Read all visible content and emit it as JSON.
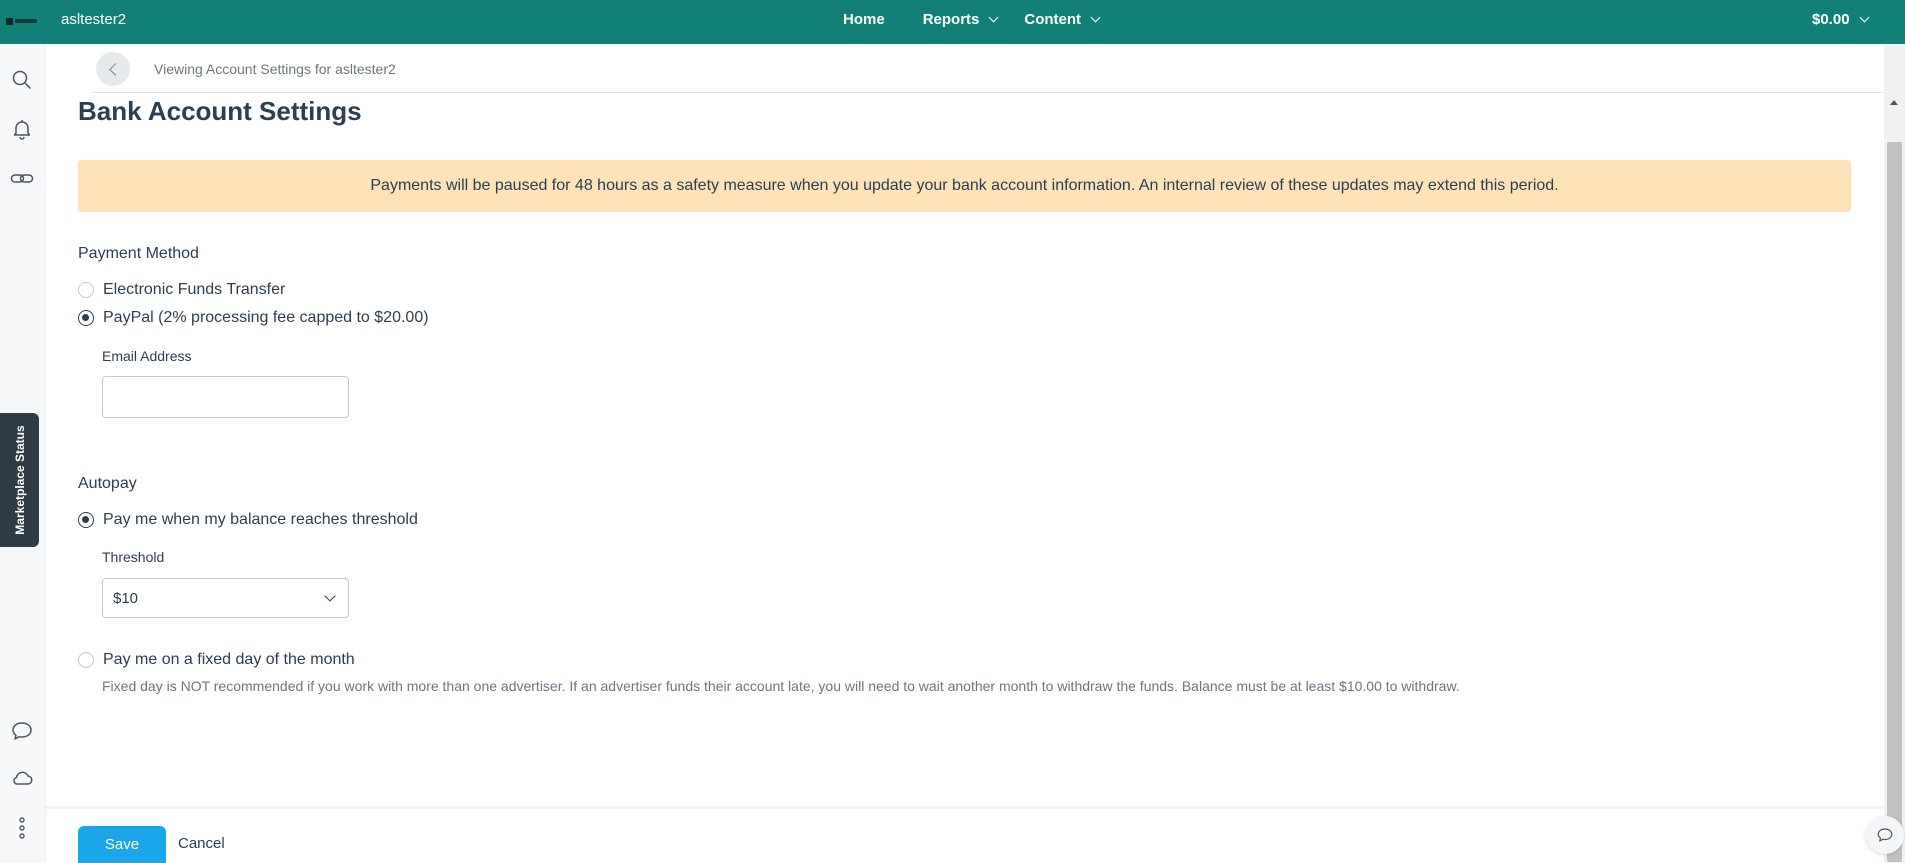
{
  "topbar": {
    "account_name": "asltester2",
    "nav": [
      {
        "label": "Home"
      },
      {
        "label": "Reports"
      },
      {
        "label": "Content"
      }
    ],
    "balance": "$0.00",
    "color": "#138078"
  },
  "sidebar": {
    "icons": [
      "search-icon",
      "bell-icon",
      "link-icon",
      "chat-icon",
      "cloud-icon",
      "more-icon"
    ],
    "marketplace_tab": "Marketplace Status"
  },
  "header": {
    "viewing_text": "Viewing Account Settings for asltester2"
  },
  "page": {
    "title": "Bank Account Settings",
    "notice": "Payments will be paused for 48 hours as a safety measure when you update your bank account information. An internal review of these updates may extend this period."
  },
  "payment_method": {
    "label": "Payment Method",
    "options": [
      {
        "label": "Electronic Funds Transfer",
        "checked": false
      },
      {
        "label": "PayPal (2% processing fee capped to $20.00)",
        "checked": true
      }
    ],
    "email": {
      "label": "Email Address",
      "value": ""
    }
  },
  "autopay": {
    "label": "Autopay",
    "threshold_option": {
      "label": "Pay me when my balance reaches threshold",
      "checked": true
    },
    "threshold": {
      "label": "Threshold",
      "selected": "$10"
    },
    "fixed_day_option": {
      "label": "Pay me on a fixed day of the month",
      "checked": false
    },
    "fixed_day_help": "Fixed day is NOT recommended if you work with more than one advertiser. If an advertiser funds their account late, you will need to wait another month to withdraw the funds. Balance must be at least $10.00 to withdraw."
  },
  "footer": {
    "save_label": "Save",
    "cancel_label": "Cancel",
    "save_color": "#1aa6e8"
  }
}
